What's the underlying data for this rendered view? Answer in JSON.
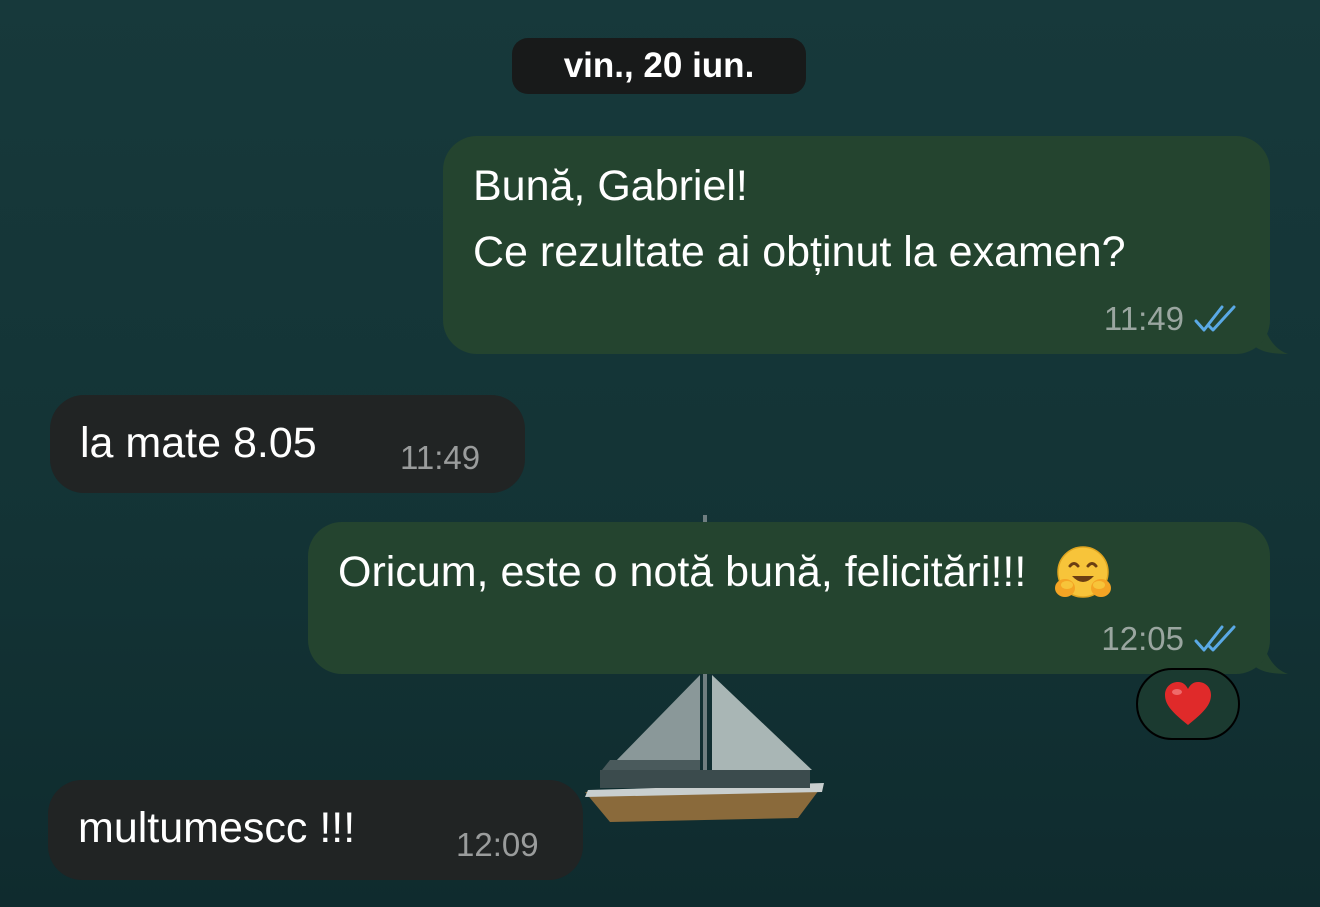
{
  "date_separator": "vin., 20 iun.",
  "messages": [
    {
      "direction": "outgoing",
      "lines": [
        "Bună, Gabriel!",
        "Ce rezultate ai obținut la examen?"
      ],
      "time": "11:49",
      "status": "read"
    },
    {
      "direction": "incoming",
      "text": "la mate 8.05",
      "time": "11:49"
    },
    {
      "direction": "outgoing",
      "text": "Oricum, este o notă bună, felicitări!!!",
      "emoji": "hugging-face",
      "time": "12:05",
      "status": "read",
      "reaction": "red-heart"
    },
    {
      "direction": "incoming",
      "text": "multumescc !!!",
      "time": "12:09"
    }
  ],
  "colors": {
    "outgoing_bubble": "#24442f",
    "incoming_bubble": "#212424",
    "read_check": "#5aa9e6",
    "background": "#153638"
  }
}
